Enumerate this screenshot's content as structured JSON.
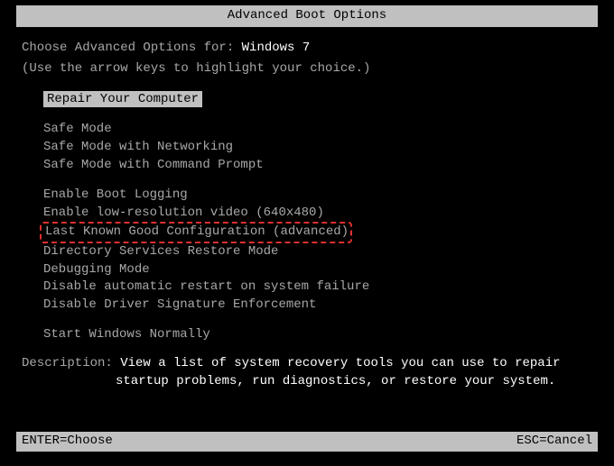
{
  "title": "Advanced Boot Options",
  "intro": {
    "prefix": "Choose Advanced Options for: ",
    "os": "Windows 7",
    "hint": "(Use the arrow keys to highlight your choice.)"
  },
  "selected": "Repair Your Computer",
  "menu": {
    "group1": [
      "Safe Mode",
      "Safe Mode with Networking",
      "Safe Mode with Command Prompt"
    ],
    "group2": [
      "Enable Boot Logging",
      "Enable low-resolution video (640x480)"
    ],
    "boxed": "Last Known Good Configuration (advanced)",
    "group3": [
      "Directory Services Restore Mode",
      "Debugging Mode",
      "Disable automatic restart on system failure",
      "Disable Driver Signature Enforcement"
    ],
    "group4": [
      "Start Windows Normally"
    ]
  },
  "description": {
    "label": "Description: ",
    "line1": "View a list of system recovery tools you can use to repair",
    "line2": "startup problems, run diagnostics, or restore your system."
  },
  "footer": {
    "left": "ENTER=Choose",
    "right": "ESC=Cancel"
  }
}
